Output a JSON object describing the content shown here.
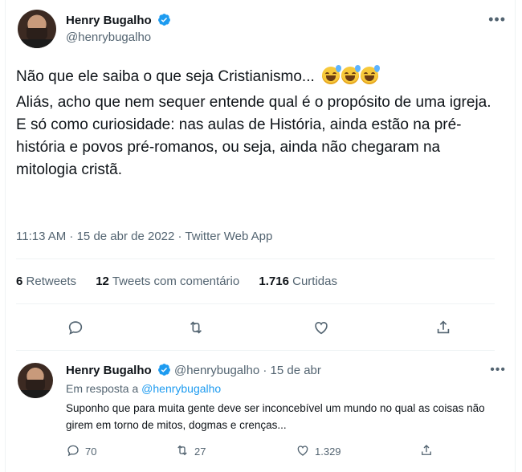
{
  "main_tweet": {
    "author_name": "Henry Bugalho",
    "handle": "@henrybugalho",
    "text_lines": [
      "Não que ele saiba o que seja Cristianismo...",
      "Aliás, acho que nem sequer entende qual é o propósito de uma igreja.",
      "E só como curiosidade: nas aulas de História, ainda estão na pré-história e povos pré-romanos, ou seja, ainda não chegaram na mitologia cristã."
    ],
    "emoji": "sweat-smile-emoji",
    "emoji_count": 3,
    "timestamp": "11:13 AM · 15 de abr de 2022 · Twitter Web App",
    "stats": {
      "retweets_count": "6",
      "retweets_label": "Retweets",
      "quotes_count": "12",
      "quotes_label": "Tweets com comentário",
      "likes_count": "1.716",
      "likes_label": "Curtidas"
    },
    "actions": [
      "reply-icon",
      "retweet-icon",
      "like-icon",
      "share-icon"
    ]
  },
  "reply_tweet": {
    "author_name": "Henry Bugalho",
    "handle": "@henrybugalho",
    "date": "· 15 de abr",
    "reply_prefix": "Em resposta a",
    "reply_target": "@henrybugalho",
    "text": "Suponho que para muita gente deve ser inconcebível um mundo no qual as coisas não girem em torno de mitos, dogmas e crenças...",
    "counts": {
      "replies": "70",
      "retweets": "27",
      "likes": "1.329"
    }
  },
  "colors": {
    "accent": "#1d9bf0",
    "muted": "#536471",
    "text": "#0f1419",
    "divider": "#eff3f4"
  }
}
